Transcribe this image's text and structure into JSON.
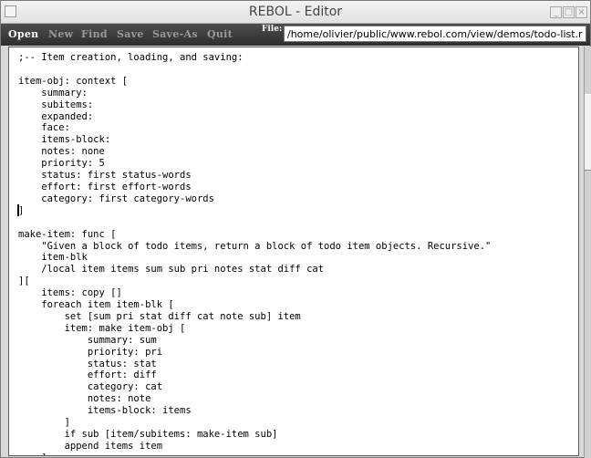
{
  "window": {
    "title": "REBOL - Editor"
  },
  "toolbar": {
    "open": "Open",
    "new": "New",
    "find": "Find",
    "save": "Save",
    "save_as": "Save-As",
    "quit": "Quit",
    "file_label": "File:",
    "file_path": "/home/olivier/public/www.rebol.com/view/demos/todo-list.r"
  },
  "editor": {
    "lines": [
      ";-- Item creation, loading, and saving:",
      "",
      "item-obj: context [",
      "    summary:",
      "    subitems:",
      "    expanded:",
      "    face:",
      "    items-block:",
      "    notes: none",
      "    priority: 5",
      "    status: first status-words",
      "    effort: first effort-words",
      "    category: first category-words",
      "]",
      "",
      "make-item: func [",
      "    \"Given a block of todo items, return a block of todo item objects. Recursive.\"",
      "    item-blk",
      "    /local item items sum sub pri notes stat diff cat",
      "][",
      "    items: copy []",
      "    foreach item item-blk [",
      "        set [sum pri stat diff cat note sub] item",
      "        item: make item-obj [",
      "            summary: sum",
      "            priority: pri",
      "            status: stat",
      "            effort: diff",
      "            category: cat",
      "            notes: note",
      "            items-block: items",
      "        ]",
      "        if sub [item/subitems: make-item sub]",
      "        append items item",
      "    ]"
    ]
  }
}
